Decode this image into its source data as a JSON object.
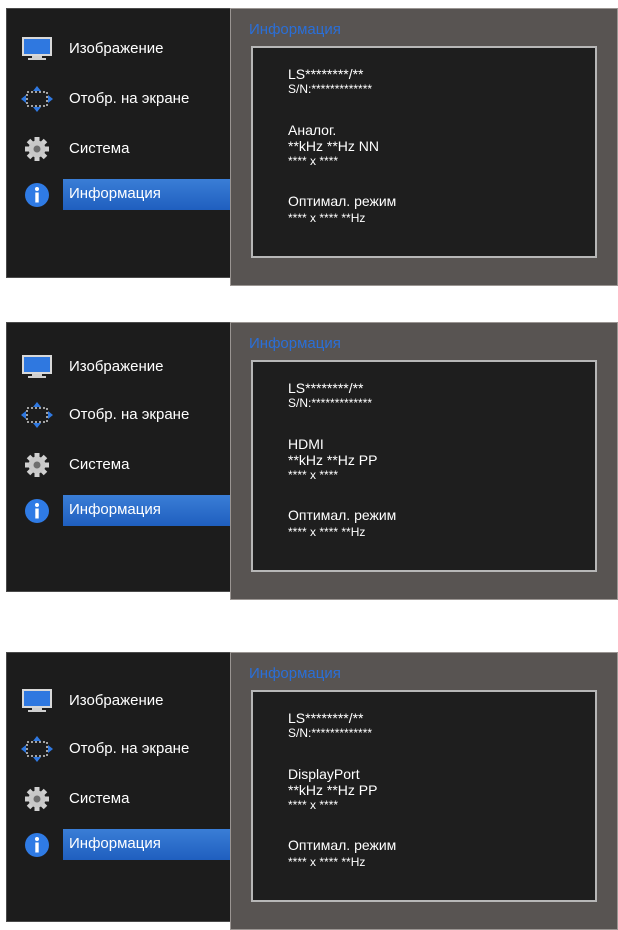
{
  "menu": {
    "items": [
      {
        "label": "Изображение",
        "icon": "monitor-icon"
      },
      {
        "label": "Отобр. на экране",
        "icon": "move-arrows-icon"
      },
      {
        "label": "Система",
        "icon": "gear-icon"
      },
      {
        "label": "Информация",
        "icon": "info-icon"
      }
    ],
    "selected": "Информация"
  },
  "screens": [
    {
      "title": "Информация",
      "model": "LS********/**",
      "serial": "S/N:*************",
      "source": "Аналог.",
      "frequency": "**kHz **Hz NN",
      "resolution": "**** x ****",
      "optimal_label": "Оптимал. режим",
      "optimal_value": "**** x **** **Hz"
    },
    {
      "title": "Информация",
      "model": "LS********/**",
      "serial": "S/N:*************",
      "source": "HDMI",
      "frequency": "**kHz **Hz PP",
      "resolution": "**** x ****",
      "optimal_label": "Оптимал. режим",
      "optimal_value": "**** x **** **Hz"
    },
    {
      "title": "Информация",
      "model": "LS********/**",
      "serial": "S/N:*************",
      "source": "DisplayPort",
      "frequency": "**kHz **Hz PP",
      "resolution": "**** x ****",
      "optimal_label": "Оптимал. режим",
      "optimal_value": "**** x **** **Hz"
    }
  ],
  "colors": {
    "selected_bar": "#2f6fd0",
    "title_text": "#2a6fd8",
    "menu_bg": "#1c1c1c",
    "panel_bg": "#585452"
  }
}
